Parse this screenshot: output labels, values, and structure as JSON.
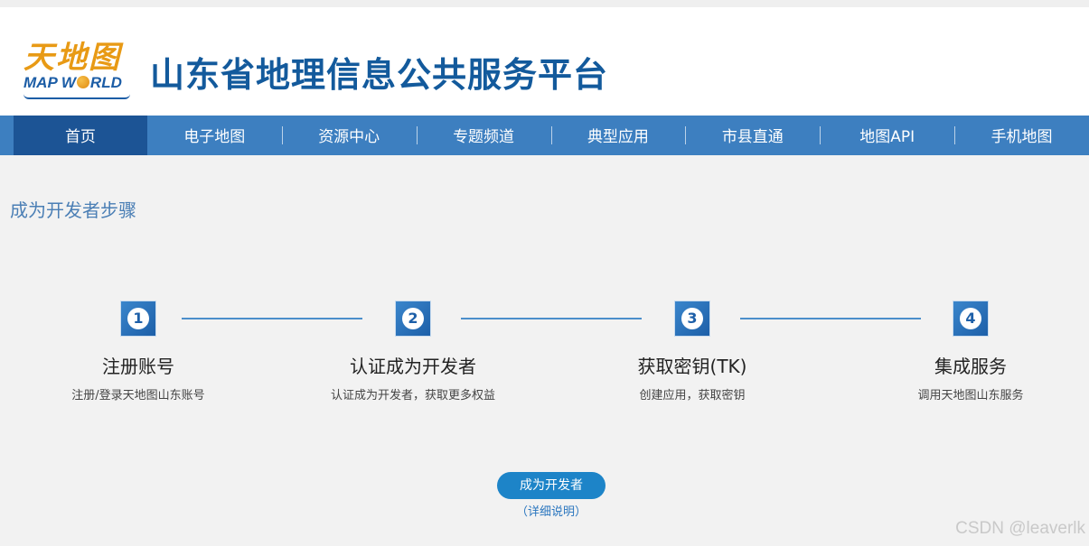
{
  "header": {
    "logo_cn": "天地图",
    "logo_en_pre": "MAP W",
    "logo_en_post": "RLD",
    "site_title": "山东省地理信息公共服务平台"
  },
  "nav": {
    "items": [
      {
        "label": "首页",
        "active": true
      },
      {
        "label": "电子地图"
      },
      {
        "label": "资源中心"
      },
      {
        "label": "专题频道"
      },
      {
        "label": "典型应用"
      },
      {
        "label": "市县直通"
      },
      {
        "label": "地图API"
      },
      {
        "label": "手机地图"
      }
    ]
  },
  "main": {
    "section_title": "成为开发者步骤",
    "steps": [
      {
        "num": "1",
        "title": "注册账号",
        "desc": "注册/登录天地图山东账号"
      },
      {
        "num": "2",
        "title": "认证成为开发者",
        "desc": "认证成为开发者，获取更多权益"
      },
      {
        "num": "3",
        "title": "获取密钥(TK)",
        "desc": "创建应用，获取密钥"
      },
      {
        "num": "4",
        "title": "集成服务",
        "desc": "调用天地图山东服务"
      }
    ],
    "cta_label": "成为开发者",
    "detail_link": "（详细说明）"
  },
  "watermark": "CSDN @leaverlk",
  "colors": {
    "nav_bg": "#3d7fc0",
    "nav_active": "#1c5495",
    "title_blue": "#135a9c",
    "cta_bg": "#1d84c8"
  }
}
